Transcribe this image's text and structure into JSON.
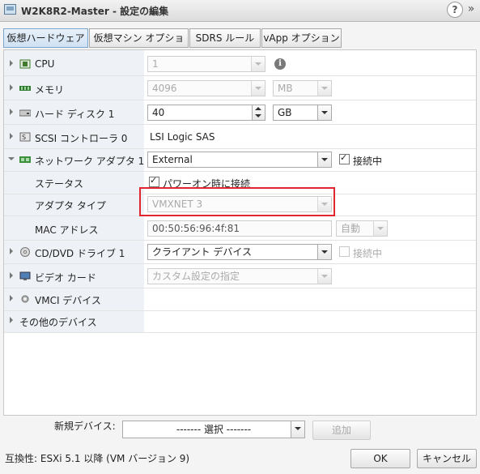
{
  "window": {
    "title": "W2K8R2-Master - 設定の編集",
    "help_label": "?",
    "expand_label": "»"
  },
  "tabs": [
    {
      "label": "仮想ハードウェア",
      "active": true
    },
    {
      "label": "仮想マシン オプション",
      "active": false
    },
    {
      "label": "SDRS ルール",
      "active": false
    },
    {
      "label": "vApp オプション",
      "active": false
    }
  ],
  "hardware": {
    "cpu": {
      "label": "CPU",
      "value": "1",
      "info_icon": "i"
    },
    "memory": {
      "label": "メモリ",
      "value": "4096",
      "unit": "MB"
    },
    "disk": {
      "label": "ハード ディスク 1",
      "value": "40",
      "unit": "GB"
    },
    "scsi": {
      "label": "SCSI コントローラ 0",
      "value": "LSI Logic SAS"
    },
    "network": {
      "label": "ネットワーク アダプタ 1",
      "value": "External",
      "connected_label": "接続中",
      "connected": true,
      "status_label": "ステータス",
      "power_on_label": "パワーオン時に接続",
      "power_on_checked": true,
      "adapter_type_label": "アダプタ タイプ",
      "adapter_type_value": "VMXNET 3",
      "mac_label": "MAC アドレス",
      "mac_value": "00:50:56:96:4f:81",
      "mac_mode": "自動"
    },
    "cddvd": {
      "label": "CD/DVD ドライブ 1",
      "value": "クライアント デバイス",
      "connected_label": "接続中",
      "connected": false
    },
    "video": {
      "label": "ビデオ カード",
      "value": "カスタム設定の指定"
    },
    "vmci": {
      "label": "VMCI デバイス"
    },
    "other": {
      "label": "その他のデバイス"
    }
  },
  "new_device": {
    "label": "新規デバイス:",
    "select_value": "------- 選択 -------",
    "add_label": "追加"
  },
  "footer": {
    "compat_text": "互換性: ESXi 5.1 以降 (VM バージョン 9)",
    "ok_label": "OK",
    "cancel_label": "キャンセル"
  },
  "colors": {
    "highlight": "#e0262e",
    "tab_active": "#cfe1f3"
  }
}
